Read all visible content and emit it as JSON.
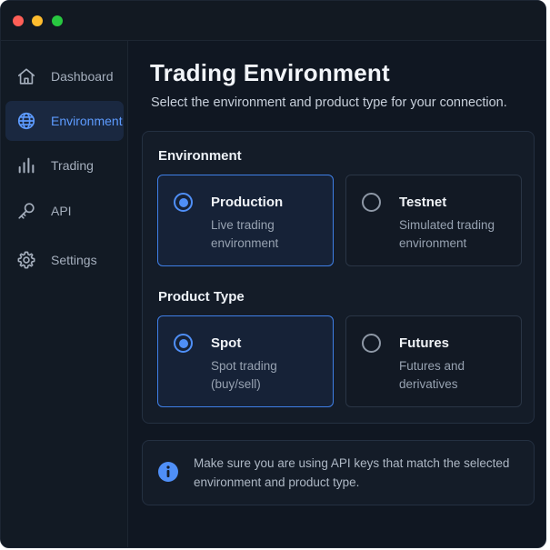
{
  "sidebar": {
    "items": [
      {
        "label": "Dashboard",
        "icon": "home-icon",
        "active": false
      },
      {
        "label": "Environment",
        "icon": "globe-icon",
        "active": true
      },
      {
        "label": "Trading",
        "icon": "bar-chart-icon",
        "active": false
      },
      {
        "label": "API",
        "icon": "key-icon",
        "active": false
      },
      {
        "label": "Settings",
        "icon": "gear-icon",
        "active": false
      }
    ]
  },
  "main": {
    "title": "Trading Environment",
    "subtitle": "Select the environment and product type for your connection.",
    "environment": {
      "label": "Environment",
      "options": [
        {
          "title": "Production",
          "desc": "Live trading environment",
          "selected": true
        },
        {
          "title": "Testnet",
          "desc": "Simulated trading environment",
          "selected": false
        }
      ]
    },
    "product_type": {
      "label": "Product Type",
      "options": [
        {
          "title": "Spot",
          "desc": "Spot trading (buy/sell)",
          "selected": true
        },
        {
          "title": "Futures",
          "desc": "Futures and derivatives",
          "selected": false
        }
      ]
    },
    "notice": {
      "icon": "info-icon",
      "text": "Make sure you are using API keys that match the selected environment and product type."
    }
  },
  "colors": {
    "accent": "#4f8ff7",
    "background": "#101722",
    "panel": "#141c28"
  }
}
